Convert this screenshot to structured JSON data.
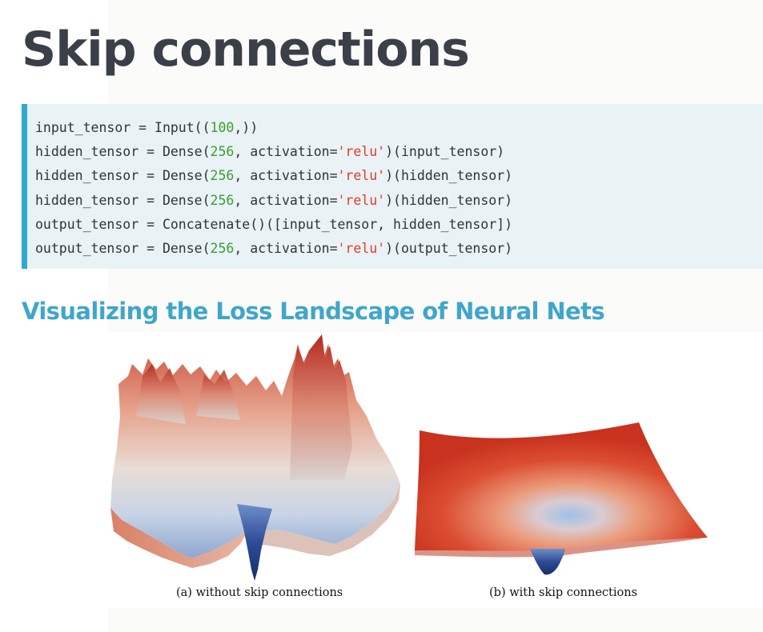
{
  "slide": {
    "title": "Skip connections"
  },
  "code": {
    "lines": [
      [
        {
          "t": "input_tensor = Input(("
        },
        {
          "t": "100",
          "k": "num"
        },
        {
          "t": ",))"
        }
      ],
      [
        {
          "t": "hidden_tensor = Dense("
        },
        {
          "t": "256",
          "k": "num"
        },
        {
          "t": ", activation="
        },
        {
          "t": "'relu'",
          "k": "str"
        },
        {
          "t": ")(input_tensor)"
        }
      ],
      [
        {
          "t": "hidden_tensor = Dense("
        },
        {
          "t": "256",
          "k": "num"
        },
        {
          "t": ", activation="
        },
        {
          "t": "'relu'",
          "k": "str"
        },
        {
          "t": ")(hidden_tensor)"
        }
      ],
      [
        {
          "t": "hidden_tensor = Dense("
        },
        {
          "t": "256",
          "k": "num"
        },
        {
          "t": ", activation="
        },
        {
          "t": "'relu'",
          "k": "str"
        },
        {
          "t": ")(hidden_tensor)"
        }
      ],
      [
        {
          "t": "output_tensor = Concatenate()([input_tensor, hidden_tensor])"
        }
      ],
      [
        {
          "t": "output_tensor = Dense("
        },
        {
          "t": "256",
          "k": "num"
        },
        {
          "t": ", activation="
        },
        {
          "t": "'relu'",
          "k": "str"
        },
        {
          "t": ")(output_tensor)"
        }
      ]
    ]
  },
  "section": {
    "title": "Visualizing the Loss Landscape of Neural Nets"
  },
  "figure": {
    "caption_a": "(a) without skip connections",
    "caption_b": "(b) with skip connections"
  },
  "colors": {
    "accent": "#2ea9cf",
    "heading": "#3a3f48",
    "section": "#3fa6cc",
    "code_bg": "#e9f3f5",
    "number": "#3b9d2e",
    "string": "#e0392b",
    "surface_red": "#d23a22",
    "surface_blue": "#1f3f86"
  }
}
